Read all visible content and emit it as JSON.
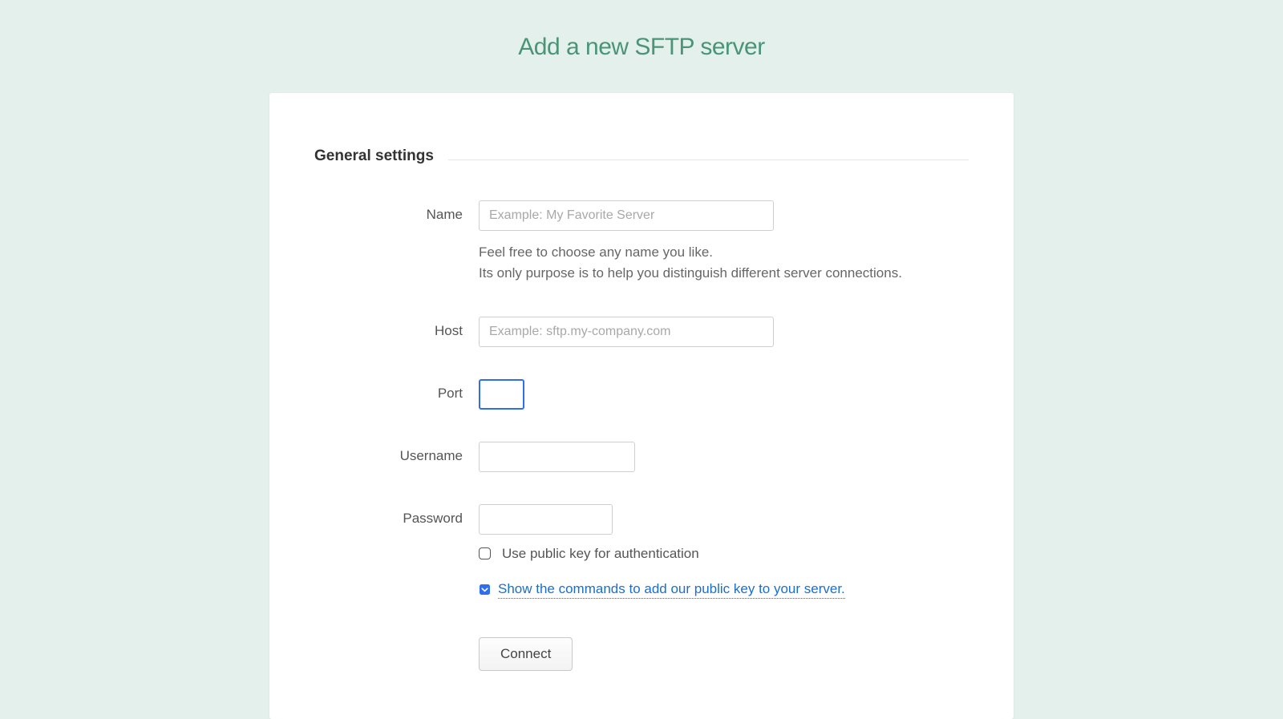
{
  "page": {
    "title": "Add a new SFTP server"
  },
  "section": {
    "title": "General settings"
  },
  "fields": {
    "name": {
      "label": "Name",
      "placeholder": "Example: My Favorite Server",
      "value": "",
      "help1": "Feel free to choose any name you like.",
      "help2": "Its only purpose is to help you distinguish different server connections."
    },
    "host": {
      "label": "Host",
      "placeholder": "Example: sftp.my-company.com",
      "value": ""
    },
    "port": {
      "label": "Port",
      "value": ""
    },
    "username": {
      "label": "Username",
      "value": ""
    },
    "password": {
      "label": "Password",
      "value": ""
    }
  },
  "auth": {
    "publicKeyLabel": "Use public key for authentication",
    "expanderLabel": "Show the commands to add our public key to your server."
  },
  "actions": {
    "connect": "Connect"
  }
}
